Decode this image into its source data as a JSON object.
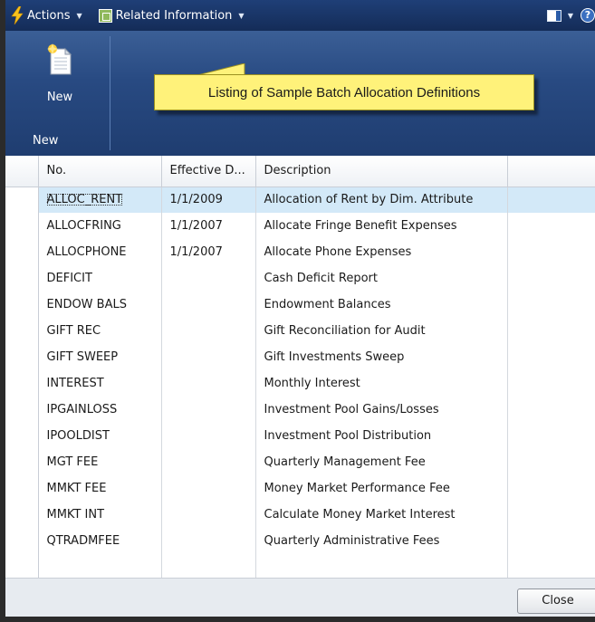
{
  "commandbar": {
    "actions_label": "Actions",
    "related_label": "Related Information"
  },
  "ribbon": {
    "new_button_label": "New",
    "group_label": "New"
  },
  "callout": {
    "text": "Listing of Sample Batch Allocation Definitions"
  },
  "table": {
    "columns": [
      "No.",
      "Effective D...",
      "Description"
    ],
    "rows": [
      {
        "no": "ALLOC_RENT",
        "date": "1/1/2009",
        "desc": "Allocation of Rent by Dim. Attribute"
      },
      {
        "no": "ALLOCFRING",
        "date": "1/1/2007",
        "desc": "Allocate Fringe Benefit Expenses"
      },
      {
        "no": "ALLOCPHONE",
        "date": "1/1/2007",
        "desc": "Allocate Phone Expenses"
      },
      {
        "no": "DEFICIT",
        "date": "",
        "desc": "Cash Deficit Report"
      },
      {
        "no": "ENDOW BALS",
        "date": "",
        "desc": "Endowment Balances"
      },
      {
        "no": "GIFT REC",
        "date": "",
        "desc": "Gift Reconciliation for Audit"
      },
      {
        "no": "GIFT SWEEP",
        "date": "",
        "desc": "Gift Investments Sweep"
      },
      {
        "no": "INTEREST",
        "date": "",
        "desc": "Monthly Interest"
      },
      {
        "no": "IPGAINLOSS",
        "date": "",
        "desc": "Investment Pool Gains/Losses"
      },
      {
        "no": "IPOOLDIST",
        "date": "",
        "desc": "Investment Pool Distribution"
      },
      {
        "no": "MGT FEE",
        "date": "",
        "desc": "Quarterly Management Fee"
      },
      {
        "no": "MMKT FEE",
        "date": "",
        "desc": "Money Market Performance Fee"
      },
      {
        "no": "MMKT INT",
        "date": "",
        "desc": "Calculate Money Market Interest"
      },
      {
        "no": "QTRADMFEE",
        "date": "",
        "desc": "Quarterly Administrative Fees"
      }
    ]
  },
  "footer": {
    "close_label": "Close"
  },
  "colors": {
    "commandbar": "#1f3f77",
    "ribbon": "#284a82",
    "callout": "#fff27a",
    "selected_row": "#d3e9f8"
  },
  "icons": [
    "lightning-icon",
    "related-information-icon",
    "panel-icon",
    "help-icon",
    "new-document-icon"
  ]
}
